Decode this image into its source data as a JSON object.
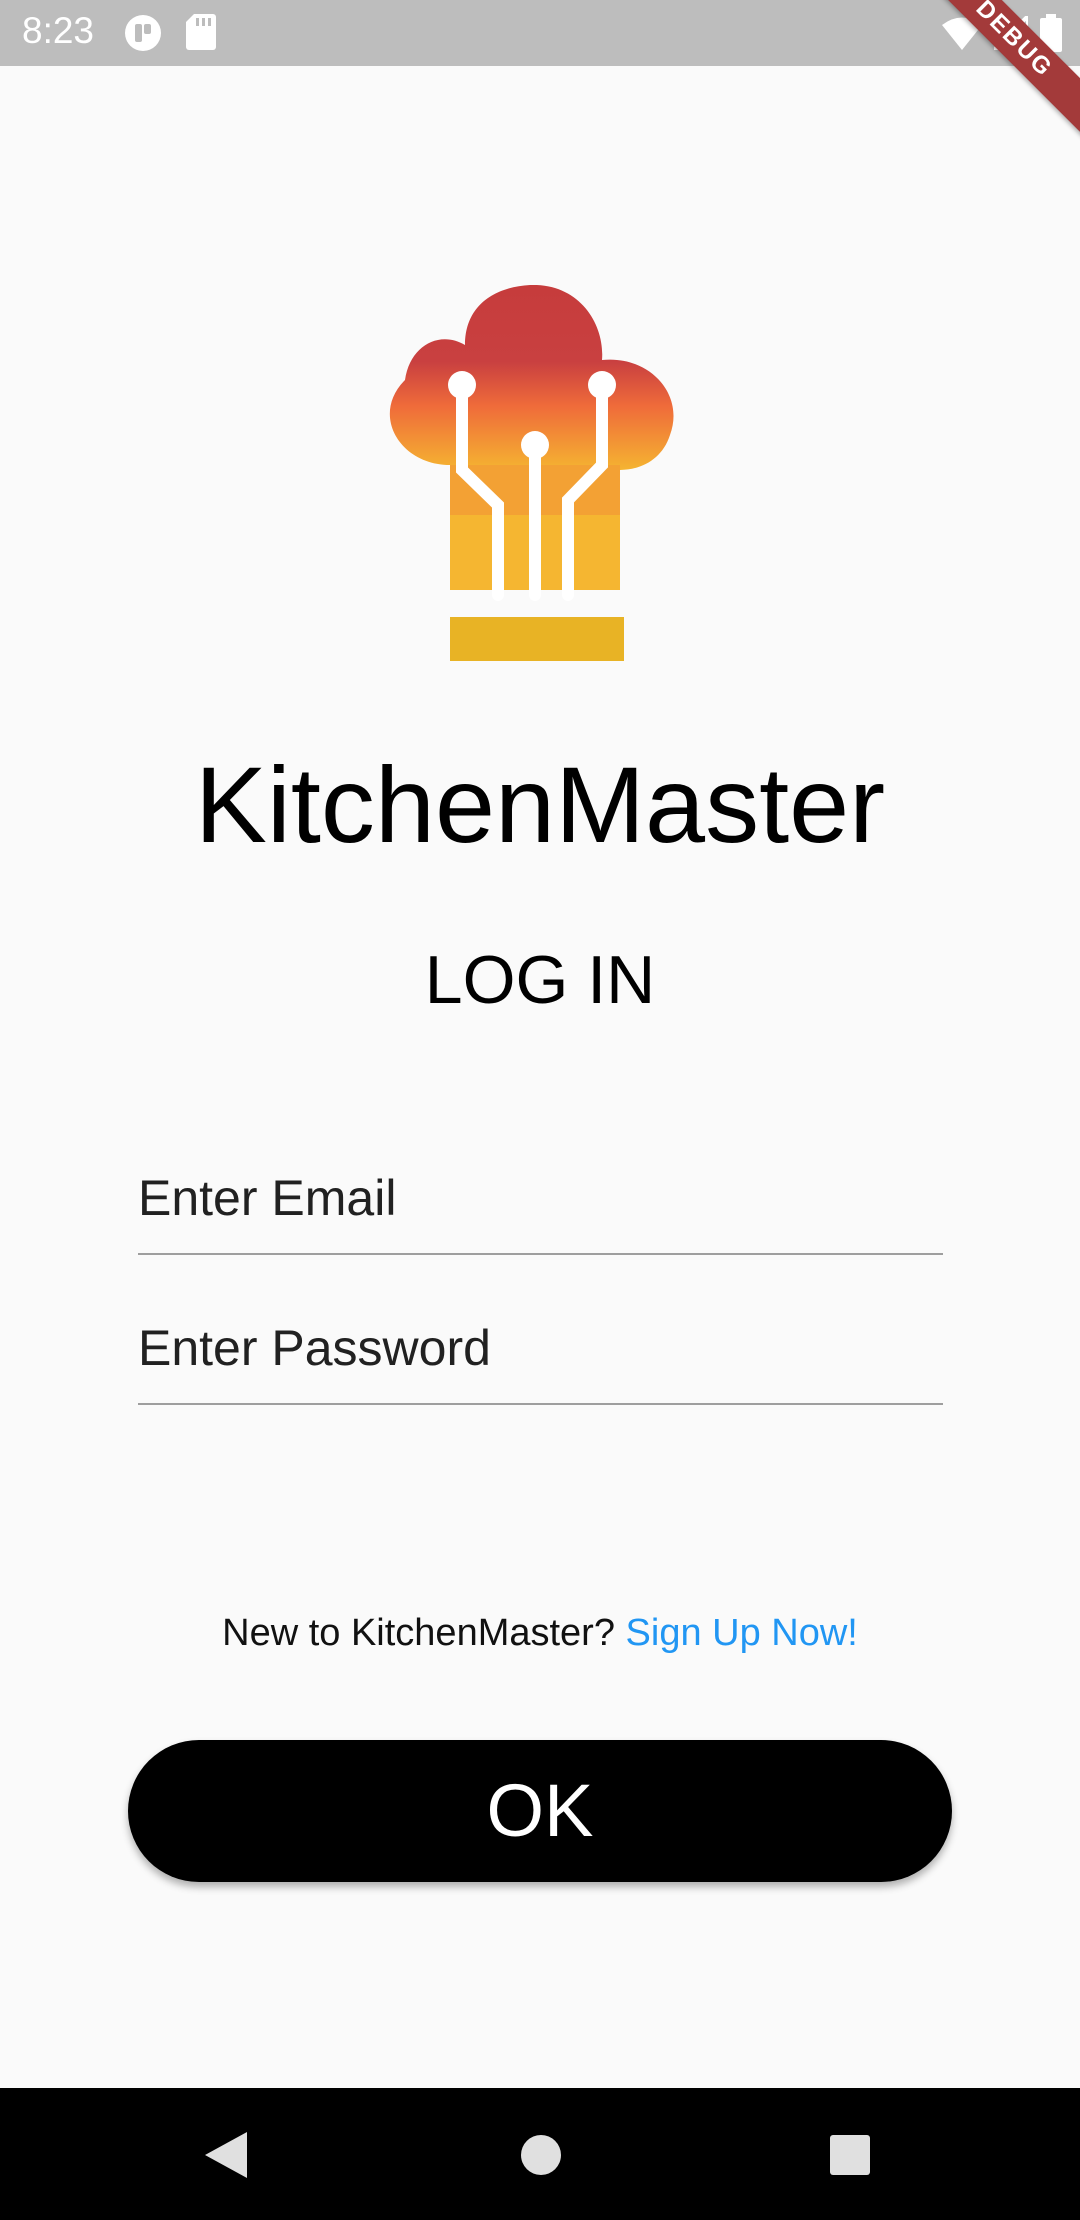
{
  "status_bar": {
    "time": "8:23",
    "icons": [
      "notification-app-icon",
      "sd-card-icon",
      "wifi-icon",
      "signal-icon",
      "battery-icon"
    ],
    "debug_banner": "DEBUG"
  },
  "app": {
    "logo_icon": "chef-hat-circuit-icon",
    "title": "KitchenMaster",
    "heading": "LOG IN"
  },
  "form": {
    "email_placeholder": "Enter Email",
    "email_value": "",
    "password_placeholder": "Enter Password",
    "password_value": ""
  },
  "signup": {
    "prompt": "New to KitchenMaster?",
    "link": "Sign Up Now!"
  },
  "actions": {
    "ok_label": "OK"
  },
  "nav": {
    "icons": [
      "back-icon",
      "home-icon",
      "recents-icon"
    ]
  },
  "colors": {
    "background": "#fafafa",
    "link": "#2196f3",
    "button": "#000000",
    "logo_top": "#c63c3c",
    "logo_mid": "#ef6b3a",
    "logo_bottom": "#f5b631"
  }
}
